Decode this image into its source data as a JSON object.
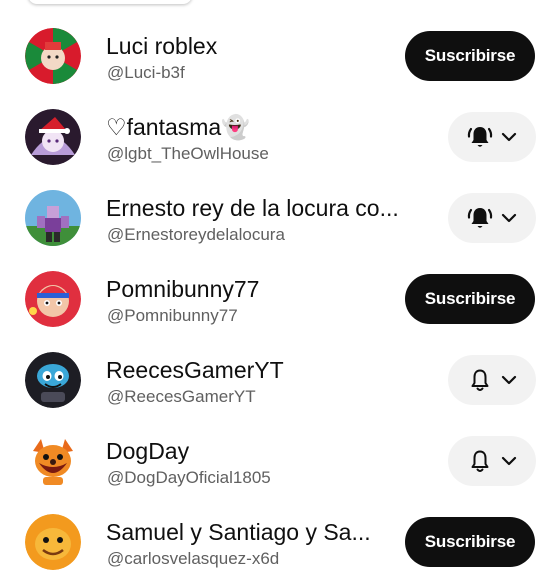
{
  "subscribe_label": "Suscribirse",
  "channels": [
    {
      "name": "Luci roblex",
      "handle": "@Luci-b3f",
      "state": "subscribe"
    },
    {
      "name": "♡fantasma👻",
      "handle": "@lgbt_TheOwlHouse",
      "state": "bell-all"
    },
    {
      "name": "Ernesto rey de la locura co...",
      "handle": "@Ernestoreydelalocura",
      "state": "bell-all"
    },
    {
      "name": "Pomnibunny77",
      "handle": "@Pomnibunny77",
      "state": "subscribe"
    },
    {
      "name": "ReecesGamerYT",
      "handle": "@ReecesGamerYT",
      "state": "bell-default"
    },
    {
      "name": "DogDay",
      "handle": "@DogDayOficial1805",
      "state": "bell-default"
    },
    {
      "name": "Samuel y Santiago y Sa...",
      "handle": "@carlosvelasquez-x6d",
      "state": "subscribe"
    }
  ],
  "icons": {
    "bell_all": "bell-ringing-filled-icon",
    "bell_default": "bell-outline-icon",
    "chevron": "chevron-down-icon"
  },
  "colors": {
    "button_dark": "#0f0f0f",
    "button_light": "#f2f2f2",
    "secondary_text": "#606060"
  }
}
